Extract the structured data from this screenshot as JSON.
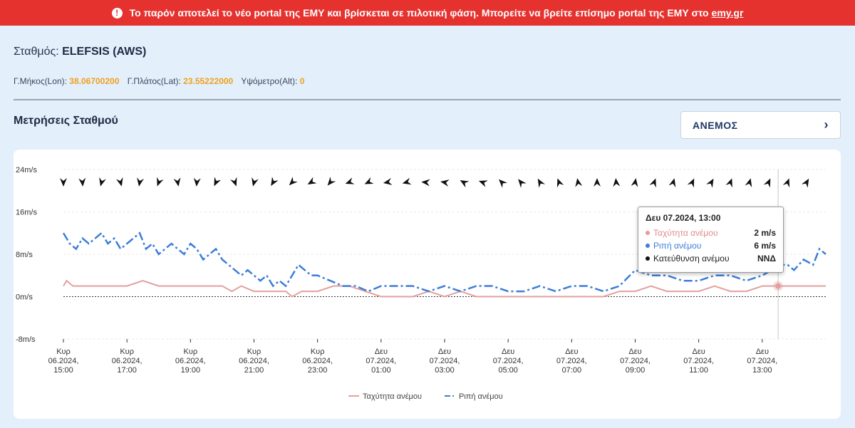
{
  "banner": {
    "text": "Το παρόν αποτελεί το νέο portal της ΕΜΥ και βρίσκεται σε πιλοτική φάση. Μπορείτε να βρείτε επίσημο portal της ΕΜΥ στο",
    "link": "emy.gr",
    "icon": "exclamation-circle-icon"
  },
  "station": {
    "label": "Σταθμός:",
    "name": "ELEFSIS (AWS)"
  },
  "coords": {
    "lon_label": "Γ.Μήκος(Lon):",
    "lon": "38.06700200",
    "lat_label": "Γ.Πλάτος(Lat):",
    "lat": "23.55222000",
    "alt_label": "Υψόμετρο(Alt):",
    "alt": "0"
  },
  "section_title": "Μετρήσεις Σταθμού",
  "selector": {
    "value": "ΑΝΕΜΟΣ",
    "icon": "chevron-right-icon"
  },
  "tooltip": {
    "title": "Δευ 07.2024, 13:00",
    "rows": [
      {
        "label": "Ταχύτητα ανέμου",
        "value": "2 m/s",
        "color": "#e59a9a"
      },
      {
        "label": "Ριπή ανέμου",
        "value": "6 m/s",
        "color": "#3c7dd9"
      },
      {
        "label": "Κατεύθυνση ανέμου",
        "value": "ΝΝΔ",
        "color": "#111111"
      }
    ]
  },
  "colors": {
    "speed": "#e3a0a0",
    "gust": "#3c7dd9",
    "direction": "#111111",
    "accent": "#f0a11e",
    "banner": "#e5322f"
  },
  "chart_data": {
    "type": "line",
    "ylim": [
      -8,
      24
    ],
    "yticks": [
      -8,
      0,
      8,
      16,
      24
    ],
    "ytick_labels": [
      "-8m/s",
      "0m/s",
      "8m/s",
      "16m/s",
      "24m/s"
    ],
    "xlim": [
      0,
      24
    ],
    "xticks": [
      {
        "x": 0,
        "label": [
          "Κυρ",
          "06.2024,",
          "15:00"
        ]
      },
      {
        "x": 2,
        "label": [
          "Κυρ",
          "06.2024,",
          "17:00"
        ]
      },
      {
        "x": 4,
        "label": [
          "Κυρ",
          "06.2024,",
          "19:00"
        ]
      },
      {
        "x": 6,
        "label": [
          "Κυρ",
          "06.2024,",
          "21:00"
        ]
      },
      {
        "x": 8,
        "label": [
          "Κυρ",
          "06.2024,",
          "23:00"
        ]
      },
      {
        "x": 10,
        "label": [
          "Δευ",
          "07.2024,",
          "01:00"
        ]
      },
      {
        "x": 12,
        "label": [
          "Δευ",
          "07.2024,",
          "03:00"
        ]
      },
      {
        "x": 14,
        "label": [
          "Δευ",
          "07.2024,",
          "05:00"
        ]
      },
      {
        "x": 16,
        "label": [
          "Δευ",
          "07.2024,",
          "07:00"
        ]
      },
      {
        "x": 18,
        "label": [
          "Δευ",
          "07.2024,",
          "09:00"
        ]
      },
      {
        "x": 20,
        "label": [
          "Δευ",
          "07.2024,",
          "11:00"
        ]
      },
      {
        "x": 22,
        "label": [
          "Δευ",
          "07.2024,",
          "13:00"
        ]
      }
    ],
    "series": [
      {
        "name": "Ταχύτητα ανέμου",
        "x": [
          0,
          0.1,
          0.3,
          0.5,
          1,
          1.5,
          2,
          2.5,
          3,
          3.5,
          4,
          4.5,
          5,
          5.3,
          5.6,
          6,
          6.5,
          7,
          7.2,
          7.5,
          8,
          8.5,
          9,
          10,
          11,
          11.5,
          12,
          12.5,
          13,
          14,
          15,
          16,
          17,
          17.5,
          18,
          18.5,
          19,
          19.5,
          20,
          20.5,
          21,
          21.5,
          22,
          22.2,
          22.5,
          23,
          23.5,
          24
        ],
        "values": [
          2,
          3,
          2,
          2,
          2,
          2,
          2,
          3,
          2,
          2,
          2,
          2,
          2,
          1,
          2,
          1,
          1,
          1,
          0,
          1,
          1,
          2,
          2,
          0,
          0,
          1,
          0,
          1,
          0,
          0,
          0,
          0,
          0,
          1,
          1,
          2,
          1,
          1,
          1,
          2,
          1,
          1,
          2,
          2,
          2,
          2,
          2,
          2
        ]
      },
      {
        "name": "Ριπή ανέμου",
        "x": [
          0,
          0.2,
          0.4,
          0.6,
          0.8,
          1,
          1.2,
          1.4,
          1.6,
          1.8,
          2,
          2.2,
          2.4,
          2.6,
          2.8,
          3,
          3.2,
          3.4,
          3.6,
          3.8,
          4,
          4.2,
          4.4,
          4.6,
          4.8,
          5,
          5.2,
          5.4,
          5.6,
          5.8,
          6,
          6.2,
          6.4,
          6.6,
          6.8,
          7,
          7.2,
          7.4,
          7.6,
          7.8,
          8,
          8.4,
          8.8,
          9.2,
          9.6,
          10,
          10.5,
          11,
          11.5,
          12,
          12.5,
          13,
          13.5,
          14,
          14.5,
          15,
          15.5,
          16,
          16.5,
          17,
          17.5,
          18,
          18.5,
          19,
          19.5,
          20,
          20.5,
          21,
          21.5,
          22,
          22.3,
          22.5,
          22.8,
          23,
          23.3,
          23.6,
          23.8,
          24
        ],
        "values": [
          12,
          10,
          9,
          11,
          10,
          11,
          12,
          10,
          11,
          9,
          10,
          11,
          12,
          9,
          10,
          8,
          9,
          10,
          9,
          8,
          10,
          9,
          7,
          8,
          9,
          7,
          6,
          5,
          4,
          5,
          4,
          3,
          4,
          2,
          3,
          2,
          4,
          6,
          5,
          4,
          4,
          3,
          2,
          2,
          1,
          2,
          2,
          2,
          1,
          2,
          1,
          2,
          2,
          1,
          1,
          2,
          1,
          2,
          2,
          1,
          2,
          5,
          4,
          4,
          3,
          3,
          4,
          4,
          3,
          4,
          5,
          6,
          6,
          5,
          7,
          6,
          9,
          8
        ]
      },
      {
        "name": "Κατεύθυνση ανέμου",
        "x": [
          0,
          0.6,
          1.2,
          1.8,
          2.4,
          3,
          3.6,
          4.2,
          4.8,
          5.4,
          6,
          6.6,
          7.2,
          7.8,
          8.4,
          9,
          9.6,
          10.2,
          10.8,
          11.4,
          12,
          12.6,
          13.2,
          13.8,
          14.4,
          15,
          15.6,
          16.2,
          16.8,
          17.4,
          18,
          18.6,
          19.2,
          19.8,
          20.4,
          21,
          21.6,
          22.2,
          22.8,
          23.4
        ],
        "values": [
          0,
          355,
          15,
          345,
          10,
          20,
          350,
          5,
          25,
          340,
          15,
          30,
          45,
          60,
          40,
          70,
          65,
          80,
          75,
          95,
          100,
          120,
          110,
          135,
          140,
          150,
          160,
          170,
          180,
          175,
          190,
          200,
          195,
          205,
          210,
          200,
          195,
          205,
          200,
          210
        ]
      }
    ],
    "legend": [
      "Ταχύτητα ανέμου",
      "Ριπή ανέμου"
    ]
  }
}
